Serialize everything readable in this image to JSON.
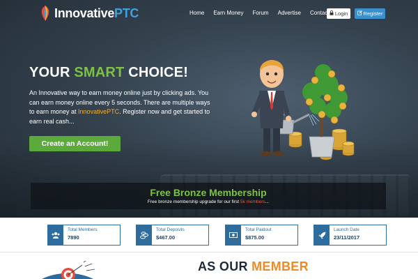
{
  "nav": {
    "logo_a": "Innovative",
    "logo_b": "PTC",
    "links": [
      "Home",
      "Earn Money",
      "Forum",
      "Advertise",
      "Contact Us"
    ],
    "login": "Login",
    "register": "Register"
  },
  "hero": {
    "headline_a": "YOUR ",
    "headline_b": "SMART",
    "headline_c": " CHOICE!",
    "intro_a": "An Innovative way to earn money online just by clicking ads. You can earn money online every 5 seconds. There are multiple ways to earn money at ",
    "intro_brand": "InnovativePTC",
    "intro_b": ". Register now and get started to earn real cash...",
    "cta": "Create an Account!"
  },
  "banner": {
    "title": "Free Bronze Membership",
    "sub_a": "Free bronze membership upgrade for our first ",
    "sub_b": "5k members",
    "sub_c": "..."
  },
  "stats": [
    {
      "label": "Total Members",
      "value": "7890",
      "icon": "users-icon"
    },
    {
      "label": "Total Deposits",
      "value": "$467.00",
      "icon": "coins-icon"
    },
    {
      "label": "Total Paidout",
      "value": "$875.00",
      "icon": "cash-icon"
    },
    {
      "label": "Launch Date",
      "value": "23/11/2017",
      "icon": "rocket-icon"
    }
  ],
  "member": {
    "title_a": "AS OUR ",
    "title_b": "MEMBER"
  },
  "colors": {
    "accent_green": "#7dc242",
    "brand_blue": "#3fa2de",
    "stat_blue": "#2e6c9e",
    "member_orange": "#f08a24"
  }
}
